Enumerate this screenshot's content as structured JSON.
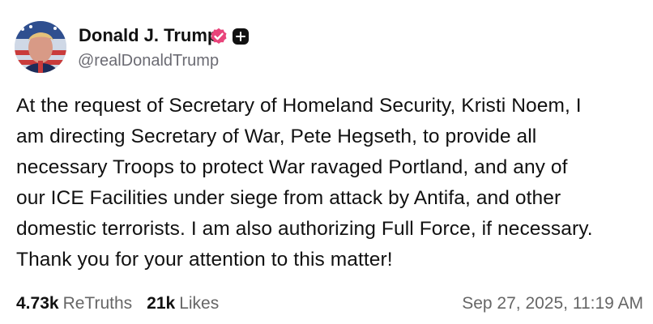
{
  "post": {
    "author": {
      "display_name": "Donald J. Trump",
      "handle": "@realDonaldTrump",
      "avatar_icon": "profile-portrait",
      "verified_icon": "verified-badge-icon",
      "plus_icon": "plus-icon"
    },
    "text": "At the request of Secretary of Homeland Security, Kristi Noem, I\nam directing Secretary of War, Pete Hegseth, to provide all\nnecessary Troops to protect War ravaged Portland, and any of\nour ICE Facilities under siege from attack by Antifa, and other\ndomestic terrorists. I am also authorizing Full Force, if necessary.\nThank you for your attention to this matter!",
    "stats": {
      "retruths_count": "4.73k",
      "retruths_label": "ReTruths",
      "likes_count": "21k",
      "likes_label": "Likes"
    },
    "timestamp": "Sep 27, 2025, 11:19 AM"
  },
  "colors": {
    "text_primary": "#111111",
    "text_secondary": "#666666",
    "verified_badge": "#e8447a",
    "background": "#ffffff"
  }
}
